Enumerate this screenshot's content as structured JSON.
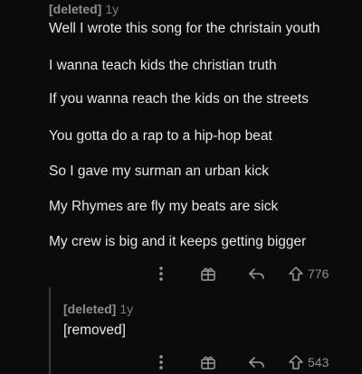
{
  "comments": [
    {
      "author": "[deleted]",
      "age": "1y",
      "lines": [
        "Well I wrote this song for the christain youth",
        "I wanna teach kids the christian truth",
        "If you wanna reach the kids on the streets",
        "You gotta do a rap to a hip-hop beat",
        "So I gave my surman an urban kick",
        "My Rhymes are fly my beats are sick",
        "My crew is big and it keeps getting bigger"
      ],
      "votes": "776"
    },
    {
      "author": "[deleted]",
      "age": "1y",
      "lines": [
        "[removed]"
      ],
      "votes": "543"
    }
  ],
  "icons": {
    "more": "more-options-icon",
    "award": "award-icon",
    "reply": "reply-icon",
    "upvote": "upvote-icon"
  },
  "colors": {
    "background": "#0b0b0b",
    "text": "#e6e6e6",
    "muted": "#8e8e8e"
  }
}
